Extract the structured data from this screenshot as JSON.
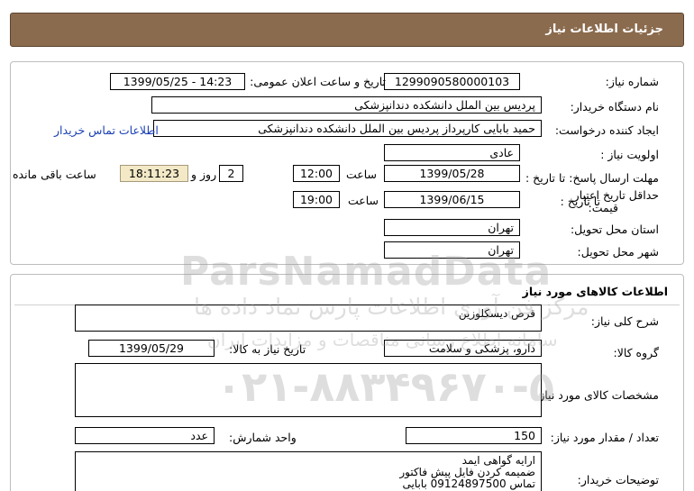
{
  "header": {
    "title": "جزئیات اطلاعات نیاز"
  },
  "info": {
    "need_number_label": "شماره نیاز:",
    "need_number": "1299090580000103",
    "announce_label": "تاریخ و ساعت اعلان عمومی:",
    "announce_value": "1399/05/25 - 14:23",
    "buyer_org_label": "نام دستگاه خریدار:",
    "buyer_org": "پردیس بین الملل دانشکده دندانپزشکی",
    "creator_label": "ایجاد کننده درخواست:",
    "creator": "حمید بابایی کارپرداز پردیس بین الملل دانشکده دندانپزشکی",
    "contact_link": "اطلاعات تماس خریدار",
    "priority_label": "اولویت نیاز :",
    "priority": "عادی",
    "reply_deadline_label": "مهلت ارسال پاسخ: تا تاریخ :",
    "reply_date": "1399/05/28",
    "time_label": "ساعت",
    "reply_time": "12:00",
    "days_value": "2",
    "days_label": "روز و",
    "remaining_time": "18:11:23",
    "remaining_label": "ساعت باقی مانده",
    "price_validity_label_1": "حداقل تاریخ اعتبار",
    "price_validity_label_2": "قیمت:",
    "until_date_label": "تا تاریخ :",
    "validity_date": "1399/06/15",
    "validity_time_label": "ساعت",
    "validity_time": "19:00",
    "province_label": "استان محل تحویل:",
    "province": "تهران",
    "city_label": "شهر محل تحویل:",
    "city": "تهران"
  },
  "goods": {
    "section_title": "اطلاعات کالاهای مورد نیاز",
    "general_desc_label": "شرح کلی نیاز:",
    "general_desc": "قرص دیسکلوزین",
    "group_label": "گروه کالا:",
    "group": "دارو، پزشکی و سلامت",
    "need_date_label": "تاریخ نیاز به کالا:",
    "need_date": "1399/05/29",
    "specs_label": "مشخصات کالای مورد نیاز:",
    "specs": "",
    "unit_label": "واحد شمارش:",
    "unit": "عدد",
    "qty_label": "تعداد / مقدار مورد نیاز:",
    "qty": "150",
    "buyer_notes_label": "توضیحات خریدار:",
    "buyer_notes": [
      "ارایه گواهی ایمد",
      "ضمیمه کردن فایل پیش فاکتور",
      "تماس  09124897500  بابایی"
    ]
  },
  "watermark": {
    "brand": "ParsNamadData",
    "line1": "مرکز فن آوری اطلاعات پارس نماد داده ها",
    "line2": "سامانه اطلاع رسانی مناقصات و مزایدات ایران",
    "phone": "۰۲۱-۸۸۳۴۹۶۷۰-۵"
  }
}
